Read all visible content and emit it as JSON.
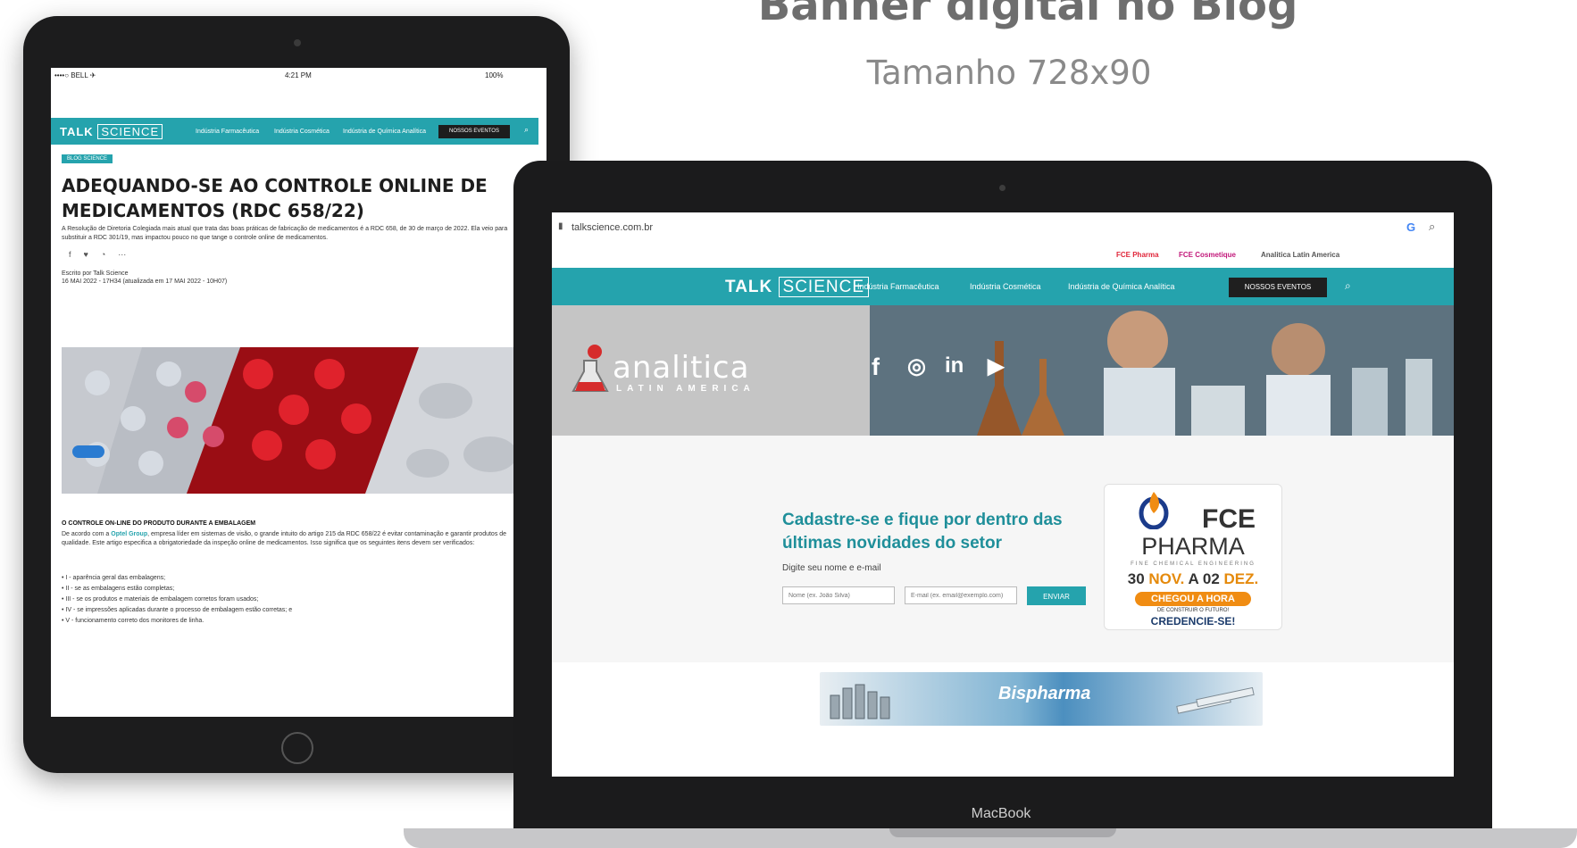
{
  "heading": {
    "title": "Banner digital no Blog",
    "subtitle": "Tamanho 728x90"
  },
  "tablet": {
    "status": {
      "carrier": "••••○ BELL ✈",
      "time": "4:21 PM",
      "battery": "100%"
    },
    "nav": {
      "logo_talk": "TALK",
      "logo_science": "SCIENCE",
      "links": [
        "Indústria Farmacêutica",
        "Indústria Cosmética",
        "Indústria de Química Analítica"
      ],
      "events": "NOSSOS EVENTOS"
    },
    "badge": "BLOG SCIENCE",
    "article_title": "ADEQUANDO-SE AO CONTROLE ONLINE DE MEDICAMENTOS (RDC 658/22)",
    "intro": "A Resolução de Diretoria Colegiada mais atual que trata das boas práticas de fabricação de medicamentos é a RDC 658, de 30 de março de 2022. Ela veio para substituir a RDC 301/19, mas impactou pouco no que tange o controle online de medicamentos.",
    "byline": "Escrito por Talk Science",
    "dates": "16 MAI 2022 - 17H34 (atualizada em 17 MAI 2022 - 10H07)",
    "section_title": "O CONTROLE ON-LINE DO PRODUTO DURANTE A EMBALAGEM",
    "section_prefix": "De acordo com a",
    "section_link": "Optel Group",
    "section_body": ", empresa líder em sistemas de visão, o grande intuito do artigo 215 da RDC 658/22 é evitar contaminação e garantir produtos de qualidade. Este artigo especifica a obrigatoriedade da inspeção online de medicamentos. Isso significa que os seguintes itens devem ser verificados:",
    "list_items": [
      "• I - aparência geral das embalagens;",
      "• II - se as embalagens estão completas;",
      "• III - se os produtos e materiais de embalagem corretos foram usados;",
      "• IV - se impressões aplicadas durante o processo de embalagem estão corretas; e",
      "• V - funcionamento correto dos monitores de linha."
    ]
  },
  "laptop": {
    "brand_label": "MacBook",
    "browser": {
      "url": "talkscience.com.br",
      "google": "G"
    },
    "topbar": {
      "links": [
        "FCE Pharma",
        "FCE Cosmetique",
        "Analitica Latin America"
      ],
      "colors": [
        "#e0263a",
        "#c2187a",
        "#555555"
      ]
    },
    "nav": {
      "logo_talk": "TALK",
      "logo_science": "SCIENCE",
      "links": [
        "Indústria Farmacêutica",
        "Indústria Cosmética",
        "Indústria de Química Analítica"
      ],
      "events": "NOSSOS EVENTOS"
    },
    "hero": {
      "brand": "analitica",
      "brand_sub": "LATIN AMERICA",
      "social": [
        "f",
        "◎",
        "in",
        "▶"
      ]
    },
    "newsletter": {
      "title": "Cadastre-se e fique por dentro das últimas novidades do setor",
      "label": "Digite seu nome e e-mail",
      "name_placeholder": "Nome (ex. João Silva)",
      "email_placeholder": "E-mail (ex. email@exemplo.com)",
      "button": "ENVIAR"
    },
    "fce_ad": {
      "name": "FCE",
      "pharma": "PHARMA",
      "tagline": "FINE CHEMICAL ENGINEERING",
      "date_start": "30",
      "date_start_month": "NOV.",
      "date_mid": "A 02",
      "date_end_month": "DEZ.",
      "cta": "CHEGOU A HORA",
      "small": "DE CONSTRUIR O FUTURO!",
      "credencie": "CREDENCIE-SE!"
    },
    "banner": {
      "brand": "Bispharma"
    }
  },
  "colors": {
    "accent": "#25a3ad",
    "text": "#1e1e1e",
    "orange": "#f08c12"
  }
}
